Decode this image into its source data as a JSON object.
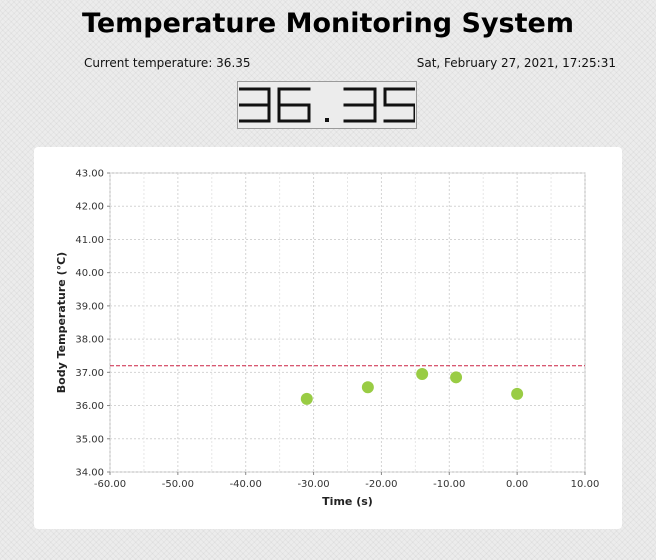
{
  "app": {
    "title": "Temperature Monitoring System"
  },
  "status": {
    "current_temperature_label": "Current temperature: 36.35",
    "datetime": "Sat, February 27, 2021, 17:25:31"
  },
  "display": {
    "value": "36.35"
  },
  "colors": {
    "point": "#99cc44",
    "threshold": "#cc2244",
    "grid": "#d4d4d4"
  },
  "chart_data": {
    "type": "scatter",
    "title": "",
    "xlabel": "Time (s)",
    "ylabel": "Body Temperature (°C)",
    "xlim": [
      -60,
      10
    ],
    "ylim": [
      34,
      43
    ],
    "x_ticks": [
      "-60.00",
      "-50.00",
      "-40.00",
      "-30.00",
      "-20.00",
      "-10.00",
      "0.00",
      "10.00"
    ],
    "y_ticks": [
      "34.00",
      "35.00",
      "36.00",
      "37.00",
      "38.00",
      "39.00",
      "40.00",
      "41.00",
      "42.00",
      "43.00"
    ],
    "grid": true,
    "threshold": 37.2,
    "points": [
      {
        "x": -31.0,
        "y": 36.2
      },
      {
        "x": -22.0,
        "y": 36.55
      },
      {
        "x": -14.0,
        "y": 36.95
      },
      {
        "x": -9.0,
        "y": 36.85
      },
      {
        "x": 0.0,
        "y": 36.35
      }
    ]
  }
}
